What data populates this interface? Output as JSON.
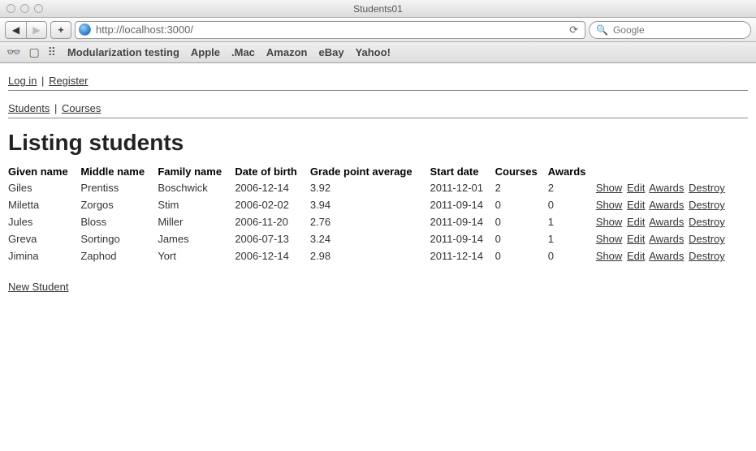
{
  "window": {
    "title": "Students01"
  },
  "toolbar": {
    "url": "http://localhost:3000/",
    "search_placeholder": "Google"
  },
  "bookmarks": [
    "Modularization testing",
    "Apple",
    ".Mac",
    "Amazon",
    "eBay",
    "Yahoo!"
  ],
  "auth": {
    "login": "Log in",
    "register": "Register"
  },
  "nav": {
    "students": "Students",
    "courses": "Courses"
  },
  "heading": "Listing students",
  "columns": [
    "Given name",
    "Middle name",
    "Family name",
    "Date of birth",
    "Grade point average",
    "Start date",
    "Courses",
    "Awards"
  ],
  "rows": [
    {
      "given": "Giles",
      "middle": "Prentiss",
      "family": "Boschwick",
      "dob": "2006-12-14",
      "gpa": "3.92",
      "start": "2011-12-01",
      "courses": "2",
      "awards": "2"
    },
    {
      "given": "Miletta",
      "middle": "Zorgos",
      "family": "Stim",
      "dob": "2006-02-02",
      "gpa": "3.94",
      "start": "2011-09-14",
      "courses": "0",
      "awards": "0"
    },
    {
      "given": "Jules",
      "middle": "Bloss",
      "family": "Miller",
      "dob": "2006-11-20",
      "gpa": "2.76",
      "start": "2011-09-14",
      "courses": "0",
      "awards": "1"
    },
    {
      "given": "Greva",
      "middle": "Sortingo",
      "family": "James",
      "dob": "2006-07-13",
      "gpa": "3.24",
      "start": "2011-09-14",
      "courses": "0",
      "awards": "1"
    },
    {
      "given": "Jimina",
      "middle": "Zaphod",
      "family": "Yort",
      "dob": "2006-12-14",
      "gpa": "2.98",
      "start": "2011-12-14",
      "courses": "0",
      "awards": "0"
    }
  ],
  "actions": {
    "show": "Show",
    "edit": "Edit",
    "awards": "Awards",
    "destroy": "Destroy"
  },
  "new_student": "New Student"
}
